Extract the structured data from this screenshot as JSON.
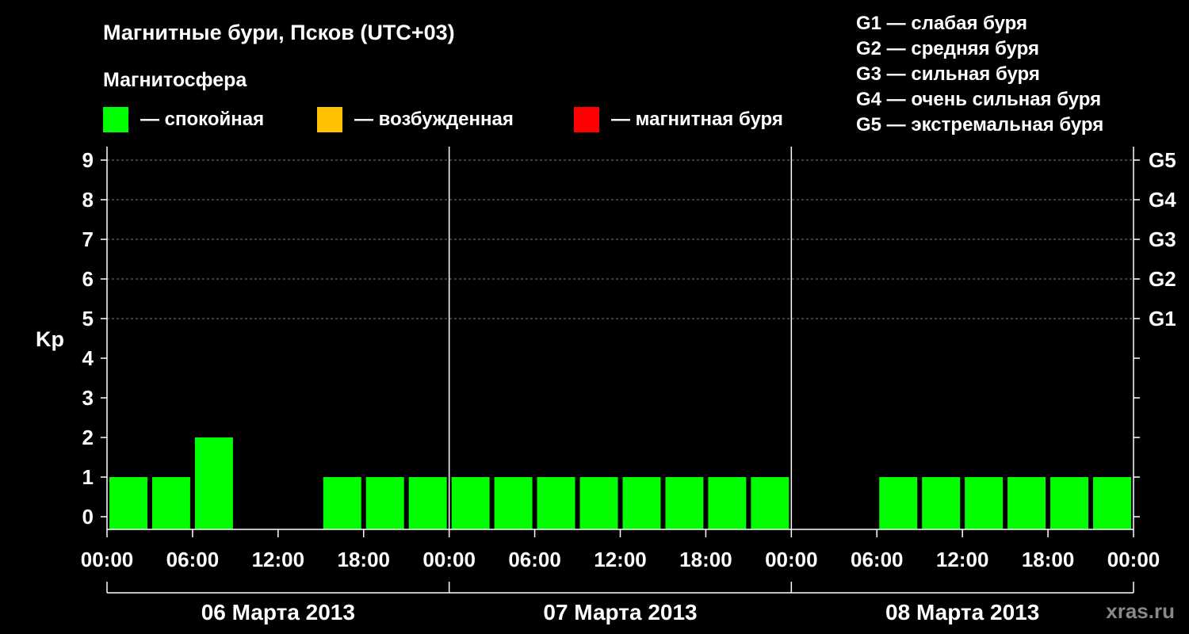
{
  "title": "Магнитные бури, Псков (UTC+03)",
  "legend": {
    "heading": "Магнитосфера",
    "items": [
      {
        "label": "— спокойная",
        "color": "#00ff00"
      },
      {
        "label": "— возбужденная",
        "color": "#ffc000"
      },
      {
        "label": "— магнитная буря",
        "color": "#ff0000"
      }
    ]
  },
  "storm_scale": [
    "G1 — слабая буря",
    "G2 — средняя буря",
    "G3 — сильная буря",
    "G4 — очень сильная буря",
    "G5 — экстремальная буря"
  ],
  "watermark": "xras.ru",
  "chart_data": {
    "type": "bar",
    "ylabel": "Kp",
    "ylim": [
      0,
      9
    ],
    "yticks": [
      0,
      1,
      2,
      3,
      4,
      5,
      6,
      7,
      8,
      9
    ],
    "g_labels": [
      {
        "kp": 5,
        "label": "G1"
      },
      {
        "kp": 6,
        "label": "G2"
      },
      {
        "kp": 7,
        "label": "G3"
      },
      {
        "kp": 8,
        "label": "G4"
      },
      {
        "kp": 9,
        "label": "G5"
      }
    ],
    "xticks": [
      "00:00",
      "06:00",
      "12:00",
      "18:00",
      "00:00",
      "06:00",
      "12:00",
      "18:00",
      "00:00",
      "06:00",
      "12:00",
      "18:00",
      "00:00"
    ],
    "days": [
      "06 Марта 2013",
      "07 Марта 2013",
      "08 Марта 2013"
    ],
    "interval_hours": 3,
    "values": [
      1,
      1,
      2,
      0,
      0,
      1,
      1,
      1,
      1,
      1,
      1,
      1,
      1,
      1,
      1,
      1,
      0,
      0,
      1,
      1,
      1,
      1,
      1,
      1
    ],
    "bar_color": "#00ff00"
  }
}
